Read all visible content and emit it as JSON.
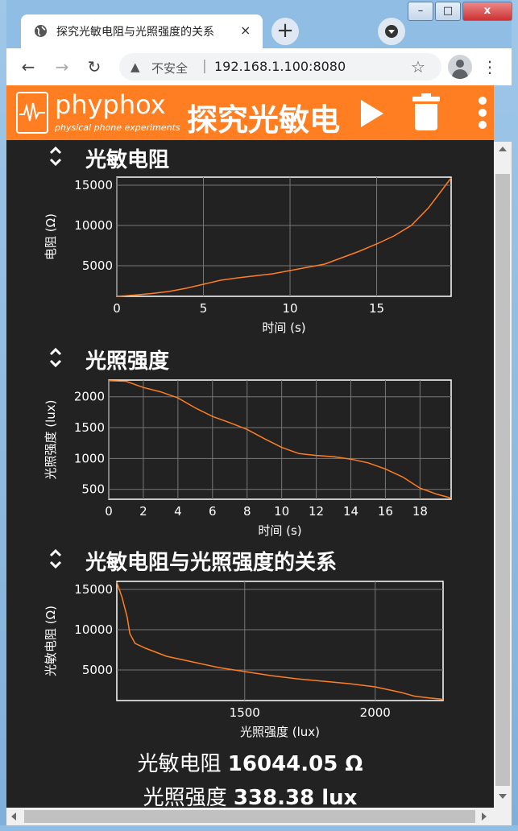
{
  "browser": {
    "tab_title": "探究光敏电阻与光照强度的关系",
    "tab_close": "×",
    "new_tab": "+",
    "window_buttons": [
      "–",
      "□",
      "x"
    ],
    "nav_back": "←",
    "nav_forward": "→",
    "nav_reload": "↻",
    "security_label": "不安全",
    "security_sep": "|",
    "url": "192.168.1.100:8080",
    "bookmark_star": "☆",
    "menu": "⋮"
  },
  "app": {
    "logo_name": "phyphox",
    "logo_subtitle": "physical phone experiments",
    "title": "探究光敏电",
    "accent_color": "#ff7e22"
  },
  "sections": [
    {
      "title": "光敏电阻"
    },
    {
      "title": "光照强度"
    },
    {
      "title": "光敏电阻与光照强度的关系"
    }
  ],
  "readouts": [
    {
      "label": "光敏电阻",
      "value": "16044.05 Ω"
    },
    {
      "label": "光照强度",
      "value": "338.38 lux"
    }
  ],
  "chart_data": [
    {
      "type": "line",
      "xlabel": "时间 (s)",
      "ylabel": "电阻 (Ω)",
      "xlim": [
        0,
        19.3
      ],
      "ylim": [
        1200,
        16000
      ],
      "xticks": [
        0,
        5,
        10,
        15
      ],
      "yticks": [
        5000,
        10000,
        15000
      ],
      "grid": true,
      "x": [
        0,
        1,
        2,
        3,
        4,
        5,
        6,
        7,
        8,
        9,
        10,
        11,
        12,
        13,
        14,
        15,
        16,
        17,
        18,
        19.3
      ],
      "y": [
        1200,
        1350,
        1550,
        1800,
        2200,
        2700,
        3200,
        3500,
        3750,
        4000,
        4400,
        4800,
        5200,
        6000,
        6800,
        7700,
        8700,
        10000,
        12200,
        15900
      ]
    },
    {
      "type": "line",
      "xlabel": "时间 (s)",
      "ylabel": "光照强度 (lux)",
      "xlim": [
        0,
        19.8
      ],
      "ylim": [
        340,
        2270
      ],
      "xticks": [
        0,
        2,
        4,
        6,
        8,
        10,
        12,
        14,
        16,
        18
      ],
      "yticks": [
        500,
        1000,
        1500,
        2000
      ],
      "grid": true,
      "x": [
        0,
        1,
        2,
        3,
        4,
        5,
        6,
        7,
        8,
        9,
        10,
        11,
        12,
        13,
        14,
        15,
        16,
        17,
        18,
        19,
        19.8
      ],
      "y": [
        2260,
        2250,
        2150,
        2080,
        1980,
        1820,
        1680,
        1580,
        1470,
        1320,
        1180,
        1080,
        1050,
        1030,
        990,
        930,
        830,
        700,
        520,
        420,
        360
      ]
    },
    {
      "type": "line",
      "xlabel": "光照强度 (lux)",
      "ylabel": "光敏电阻 (Ω)",
      "xlim": [
        1010,
        2260
      ],
      "ylim": [
        1200,
        16000
      ],
      "xticks": [
        1500,
        2000
      ],
      "yticks": [
        5000,
        10000,
        15000
      ],
      "grid": true,
      "x": [
        1010,
        1030,
        1050,
        1060,
        1080,
        1120,
        1200,
        1300,
        1400,
        1500,
        1600,
        1700,
        1800,
        1900,
        2000,
        2100,
        2150,
        2200,
        2260
      ],
      "y": [
        15900,
        14000,
        11500,
        9500,
        8300,
        7700,
        6700,
        6000,
        5300,
        4800,
        4300,
        3900,
        3600,
        3300,
        2900,
        2200,
        1750,
        1550,
        1350
      ]
    }
  ]
}
